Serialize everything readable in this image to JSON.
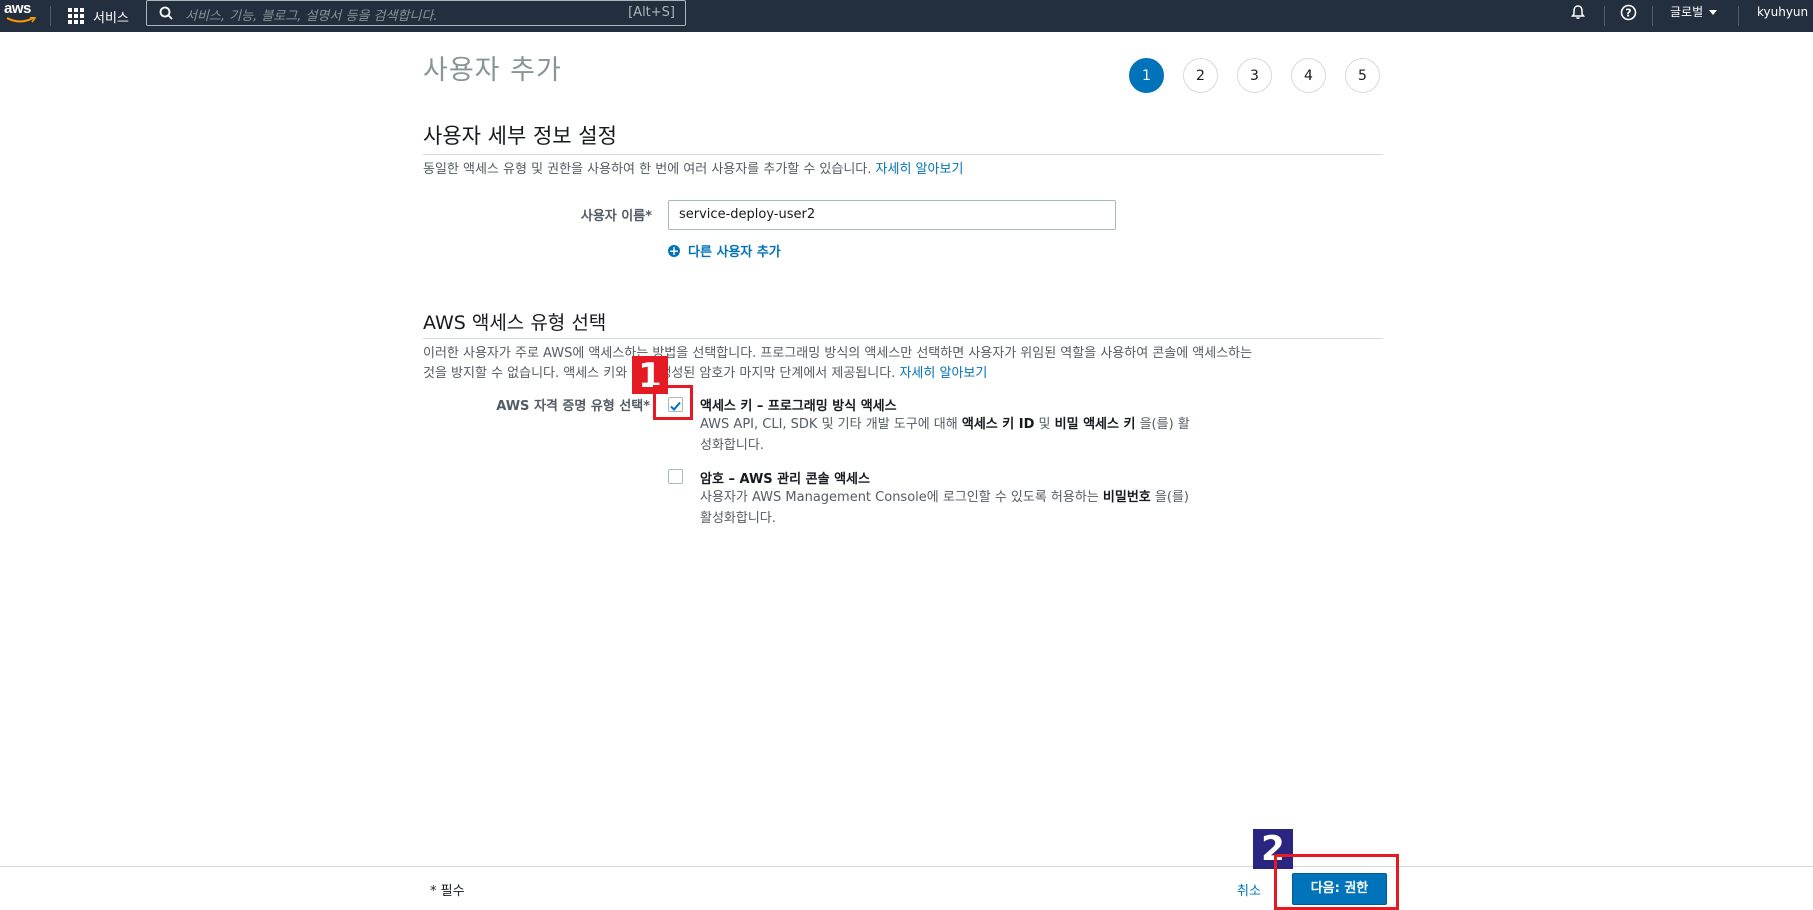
{
  "nav": {
    "logo": "aws",
    "services": "서비스",
    "search_placeholder": "서비스, 기능, 블로그, 설명서 등을 검색합니다.",
    "search_shortcut": "[Alt+S]",
    "region": "글로벌",
    "user": "kyuhyun"
  },
  "page": {
    "title": "사용자 추가",
    "steps": [
      "1",
      "2",
      "3",
      "4",
      "5"
    ],
    "current_step": "1"
  },
  "details": {
    "heading": "사용자 세부 정보 설정",
    "description": "동일한 액세스 유형 및 권한을 사용하여 한 번에 여러 사용자를 추가할 수 있습니다.",
    "learn_more": "자세히 알아보기",
    "username_label": "사용자 이름*",
    "username_value": "service-deploy-user2",
    "add_user": "다른 사용자 추가"
  },
  "access": {
    "heading": "AWS 액세스 유형 선택",
    "description_line1": "이러한 사용자가 주로 AWS에 액세스하는 방법을 선택합니다. 프로그래밍 방식의 액세스만 선택하면 사용자가 위임된 역할을 사용하여 콘솔에 액세스하는",
    "description_line2": "것을 방지할 수 없습니다. 액세스 키와 자동 생성된 암호가 마지막 단계에서 제공됩니다.",
    "learn_more": "자세히 알아보기",
    "credential_label": "AWS 자격 증명 유형 선택*",
    "options": [
      {
        "title": "액세스 키 – 프로그래밍 방식 액세스",
        "desc_pre": "AWS API, CLI, SDK 및 기타 개발 도구에 대해",
        "bold1": "액세스 키 ID",
        "mid": "및",
        "bold2": "비밀 액세스 키",
        "desc_post": "을(를) 활",
        "desc_line2": "성화합니다.",
        "checked": true
      },
      {
        "title": "암호 – AWS 관리 콘솔 액세스",
        "desc_pre": "사용자가 AWS Management Console에 로그인할 수 있도록 허용하는",
        "bold1": "비밀번호",
        "desc_post": "을(를)",
        "desc_line2": "활성화합니다.",
        "checked": false
      }
    ]
  },
  "annotations": [
    "1",
    "2"
  ],
  "colors": {
    "nav_bg": "#232f3e",
    "accent": "#0073bb",
    "annotation_red": "#e41b23",
    "annotation_navy": "#2a2580"
  },
  "footer": {
    "required": "* 필수",
    "cancel": "취소",
    "next": "다음: 권한"
  }
}
